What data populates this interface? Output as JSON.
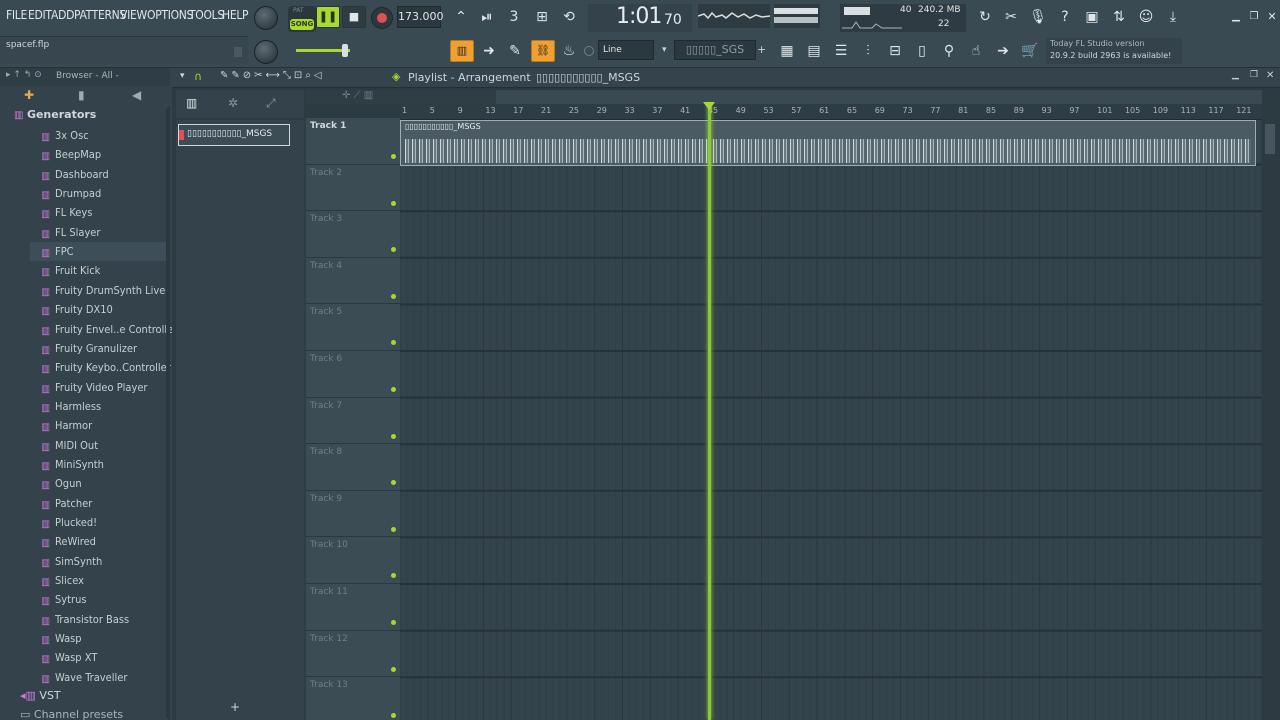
{
  "menu": [
    "FILE",
    "EDIT",
    "ADD",
    "PATTERNS",
    "VIEW",
    "OPTIONS",
    "TOOLS",
    "HELP"
  ],
  "transport": {
    "mode_top": "PAT",
    "mode_bottom": "SONG",
    "tempo": "173.000",
    "time": "1:01",
    "time_sub": "70",
    "cpu": "40",
    "mem": "240.2 MB",
    "voices": "22"
  },
  "hint_left": "spacef.flp",
  "snap": "Line",
  "pattern_picker": "▯▯▯▯▯_SGS",
  "news": {
    "line1": "Today  FL Studio version",
    "line2": "20.9.2 build 2963 is available!"
  },
  "browser": {
    "title": "Browser - All -",
    "root": "Generators",
    "items": [
      "3x Osc",
      "BeepMap",
      "Dashboard",
      "Drumpad",
      "FL Keys",
      "FL Slayer",
      "FPC",
      "Fruit Kick",
      "Fruity DrumSynth Live",
      "Fruity DX10",
      "Fruity Envel..e Controller",
      "Fruity Granulizer",
      "Fruity Keybo..Controller",
      "Fruity Video Player",
      "Harmless",
      "Harmor",
      "MIDI Out",
      "MiniSynth",
      "Ogun",
      "Patcher",
      "Plucked!",
      "ReWired",
      "SimSynth",
      "Slicex",
      "Sytrus",
      "Transistor Bass",
      "Wasp",
      "Wasp XT",
      "Wave Traveller"
    ],
    "vst": "VST",
    "channel_presets": "Channel presets",
    "selected_index": 6
  },
  "playlist": {
    "title": "Playlist - Arrangement",
    "clip_name": "▯▯▯▯▯▯▯▯▯▯▯_MSGS",
    "pattern_item": "▯▯▯▯▯▯▯▯▯▯▯_MSGS",
    "tracks": [
      "Track 1",
      "Track 2",
      "Track 3",
      "Track 4",
      "Track 5",
      "Track 6",
      "Track 7",
      "Track 8",
      "Track 9",
      "Track 10",
      "Track 11",
      "Track 12",
      "Track 13"
    ],
    "ruler": [
      "1",
      "5",
      "9",
      "13",
      "17",
      "21",
      "25",
      "29",
      "33",
      "37",
      "41",
      "45",
      "49",
      "53",
      "57",
      "61",
      "65",
      "69",
      "73",
      "77",
      "81",
      "85",
      "89",
      "93",
      "97",
      "101",
      "105",
      "109",
      "113",
      "117",
      "121"
    ],
    "add_pattern": "+"
  },
  "colors": {
    "accent_green": "#a8d932",
    "orange": "#f0a030",
    "record": "#e05050",
    "clip": "#6a7a82"
  }
}
